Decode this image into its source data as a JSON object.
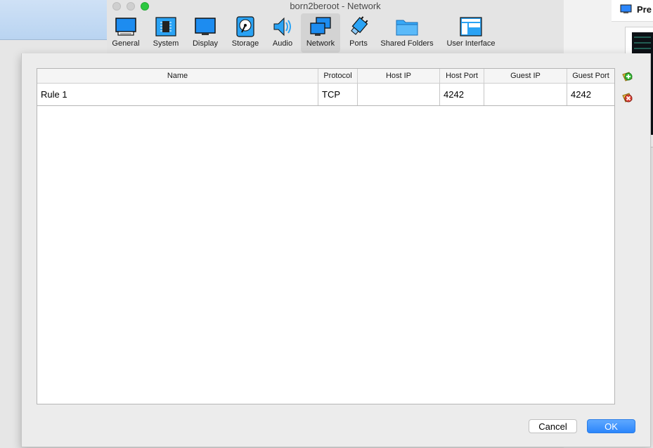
{
  "window": {
    "title": "born2beroot - Network"
  },
  "toolbar": {
    "items": [
      {
        "label": "General",
        "icon": "general-icon"
      },
      {
        "label": "System",
        "icon": "system-chip-icon"
      },
      {
        "label": "Display",
        "icon": "display-monitor-icon"
      },
      {
        "label": "Storage",
        "icon": "storage-disk-icon"
      },
      {
        "label": "Audio",
        "icon": "audio-speaker-icon"
      },
      {
        "label": "Network",
        "icon": "network-icon",
        "selected": true
      },
      {
        "label": "Ports",
        "icon": "ports-plug-icon"
      },
      {
        "label": "Shared Folders",
        "icon": "folder-icon"
      },
      {
        "label": "User Interface",
        "icon": "user-interface-icon"
      }
    ]
  },
  "table": {
    "columns": [
      "Name",
      "Protocol",
      "Host IP",
      "Host Port",
      "Guest IP",
      "Guest Port"
    ],
    "rows": [
      {
        "name": "Rule 1",
        "protocol": "TCP",
        "host_ip": "",
        "host_port": "4242",
        "guest_ip": "",
        "guest_port": "4242"
      }
    ]
  },
  "side_buttons": {
    "add_icon": "add-rule-icon",
    "remove_icon": "remove-rule-icon"
  },
  "buttons": {
    "cancel": "Cancel",
    "ok": "OK"
  },
  "background": {
    "preview_label": "Pre"
  },
  "colors": {
    "accent": "#2c86fb",
    "selected_tab": "#d3d3d3",
    "traffic_green": "#2bc840"
  }
}
